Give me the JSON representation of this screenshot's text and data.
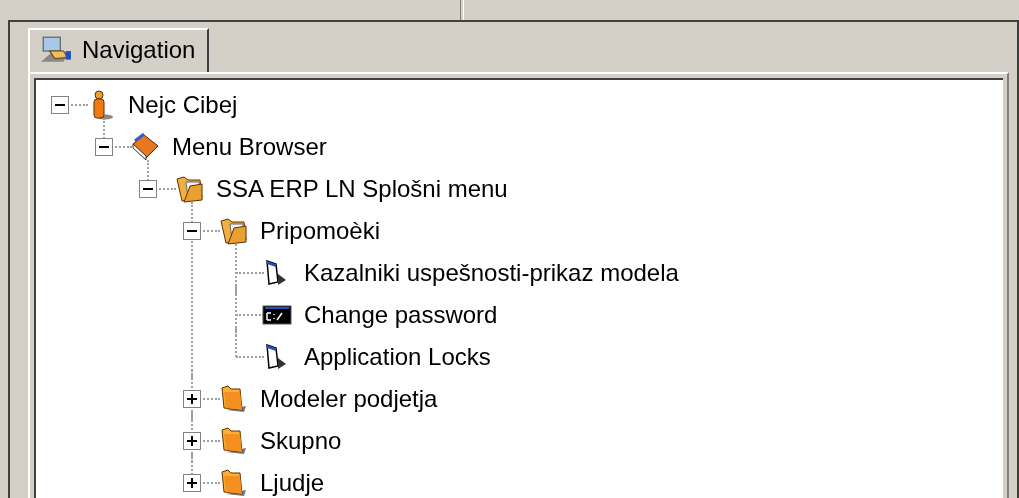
{
  "tabs": [
    {
      "label": "Navigation",
      "selected": true
    }
  ],
  "tree": [
    {
      "label": "Nejc Cibej",
      "kind": "person",
      "expanded": true,
      "children": [
        {
          "label": "Menu Browser",
          "kind": "book",
          "expanded": true,
          "children": [
            {
              "label": "SSA ERP LN Splošni menu",
              "kind": "openfolder",
              "expanded": true,
              "children": [
                {
                  "label": "Pripomoèki",
                  "kind": "openfolder",
                  "expanded": true,
                  "children": [
                    {
                      "label": "Kazalniki uspešnosti-prikaz modela",
                      "kind": "window"
                    },
                    {
                      "label": "Change password",
                      "kind": "console"
                    },
                    {
                      "label": "Application Locks",
                      "kind": "window"
                    }
                  ]
                },
                {
                  "label": "Modeler podjetja",
                  "kind": "folder",
                  "expanded": false
                },
                {
                  "label": "Skupno",
                  "kind": "folder",
                  "expanded": false
                },
                {
                  "label": "Ljudje",
                  "kind": "folder",
                  "expanded": false
                }
              ]
            }
          ]
        }
      ]
    }
  ]
}
